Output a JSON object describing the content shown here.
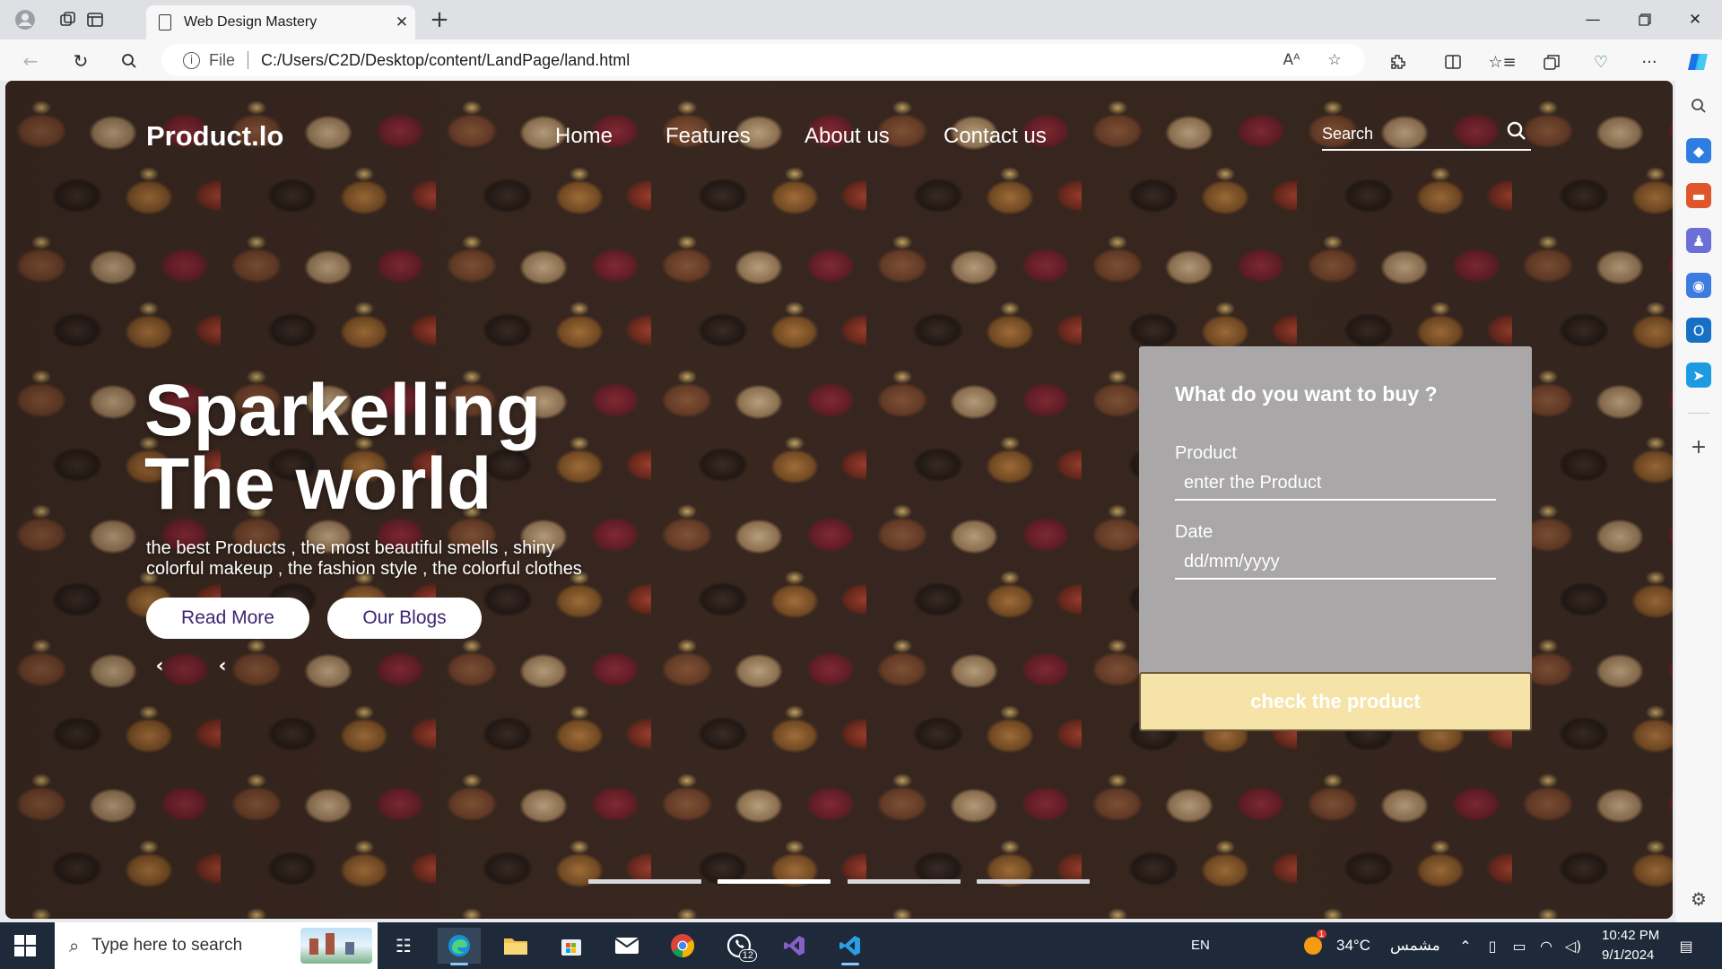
{
  "browser": {
    "tab_title": "Web Design Mastery",
    "tab_close": "✕",
    "new_tab": "+",
    "url_scheme_label": "File",
    "url": "C:/Users/C2D/Desktop/content/LandPage/land.html"
  },
  "page": {
    "brand": "Product.lo",
    "nav": [
      "Home",
      "Features",
      "About us",
      "Contact us"
    ],
    "search_placeholder": "Search",
    "hero_title_line1": "Sparkelling",
    "hero_title_line2": "The world",
    "hero_subtitle": "the best Products , the most beautiful smells , shiny colorful makeup , the fashion style , the colorful clothes",
    "btn_read_more": "Read More",
    "btn_blogs": "Our Blogs",
    "arrow_prev": "‹",
    "arrow_next": "‹",
    "slide_indicators": 4,
    "active_slide": 2
  },
  "form": {
    "title": "What do you want to buy ?",
    "product_label": "Product",
    "product_placeholder": "enter the Product",
    "date_label": "Date",
    "date_placeholder": "dd/mm/yyyy",
    "submit": "check the product"
  },
  "taskbar": {
    "search_text": "Type here to search",
    "language": "EN",
    "temperature": "34°C",
    "weather": "مشمس",
    "time": "10:42 PM",
    "date": "9/1/2024",
    "whatsapp_badge": "12",
    "weather_badge": "1"
  },
  "colors": {
    "panel_bg": "#a9a7a8",
    "check_button_bg": "#f5e3a8",
    "pill_text": "#3a2574",
    "taskbar_bg": "#1e2a3a"
  }
}
